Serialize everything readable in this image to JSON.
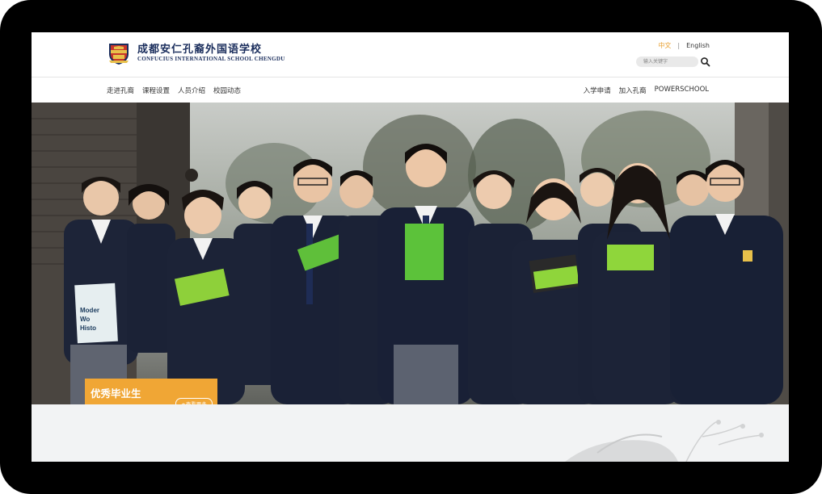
{
  "brand": {
    "name_cn": "成都安仁孔裔外国语学校",
    "name_en": "CONFUCIUS INTERNATIONAL SCHOOL CHENGDU"
  },
  "lang": {
    "cn": "中文",
    "separator": "|",
    "en": "English"
  },
  "search": {
    "placeholder": "输入关键字"
  },
  "nav": {
    "left": [
      "走进孔裔",
      "课程设置",
      "人员介绍",
      "校园动态"
    ],
    "right": [
      "入学申请",
      "加入孔裔",
      "POWERSCHOOL"
    ]
  },
  "hero": {
    "badge_title": "优秀毕业生",
    "badge_button": "+查看更多",
    "book_text": [
      "Moder",
      "Wo",
      "Histo"
    ],
    "slides": 3,
    "active_slide": 1
  },
  "colors": {
    "accent": "#f0a635",
    "brand_navy": "#1a2d5c",
    "frame": "#000000"
  }
}
